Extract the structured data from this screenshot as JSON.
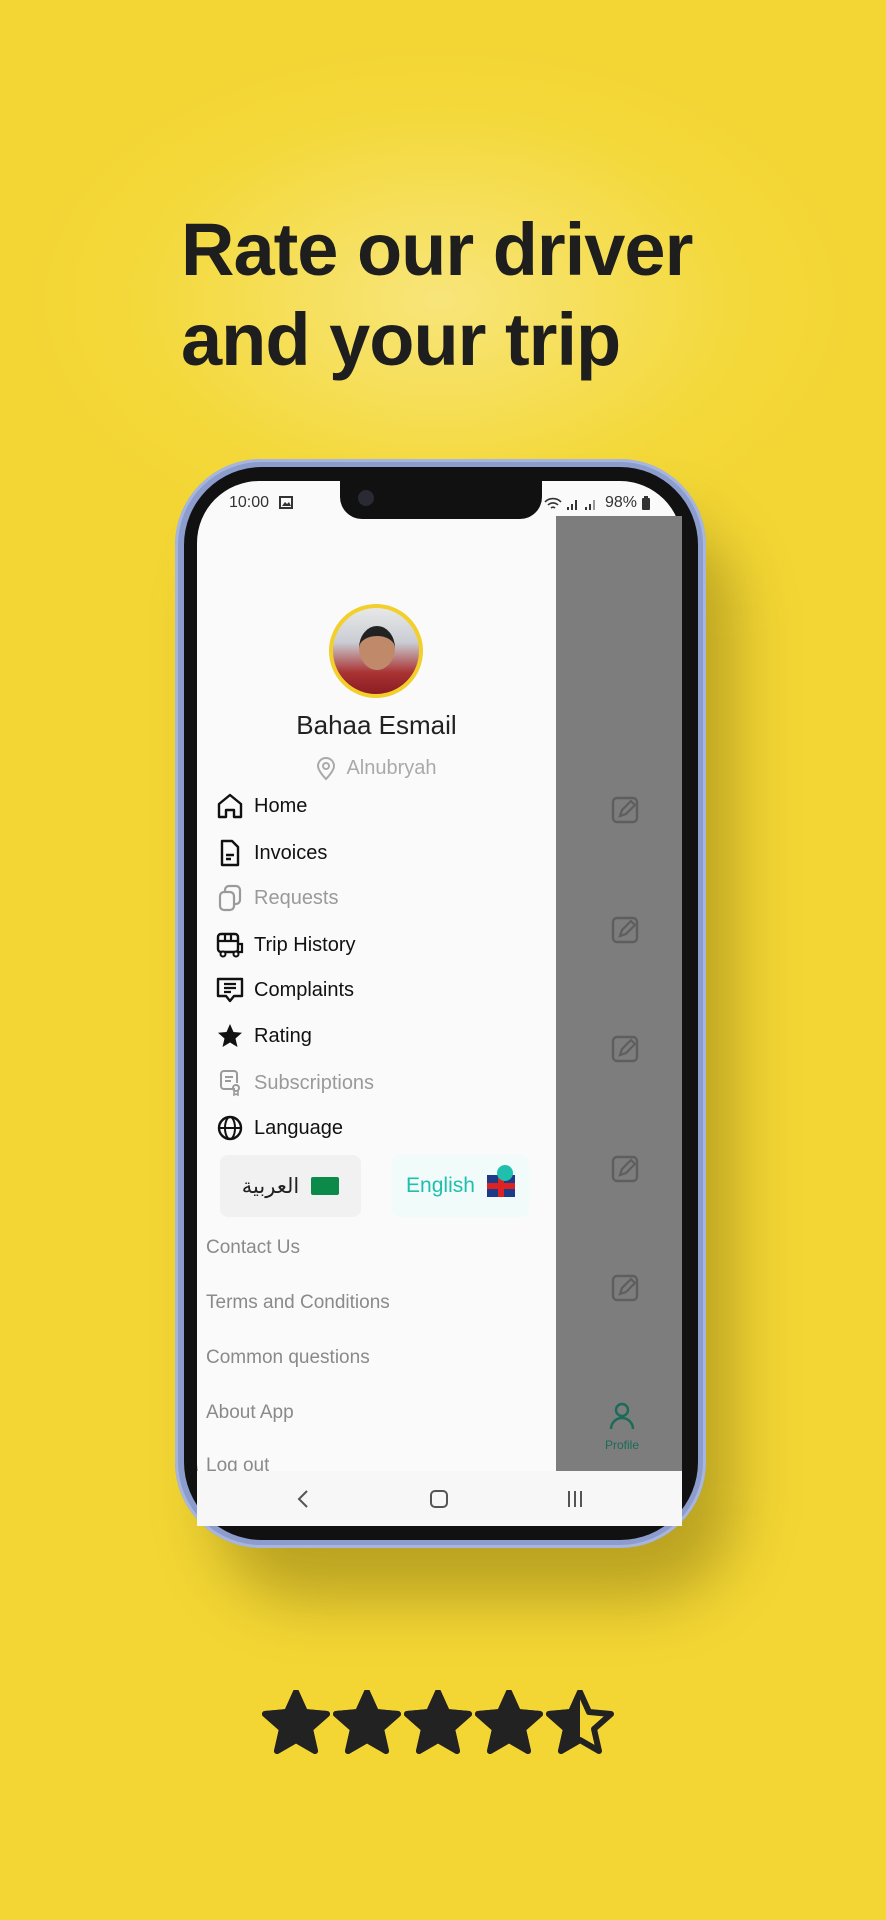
{
  "headline": {
    "line1": "Rate our driver",
    "line2": "and your trip"
  },
  "status_bar": {
    "time": "10:00",
    "battery": "98%",
    "icons": [
      "gallery-icon",
      "wifi-icon",
      "signal-icon",
      "signal-icon",
      "battery-icon"
    ]
  },
  "profile": {
    "name": "Bahaa Esmail",
    "location": "Alnubryah"
  },
  "menu": [
    {
      "label": "Home",
      "icon": "home-icon",
      "enabled": true
    },
    {
      "label": "Invoices",
      "icon": "document-icon",
      "enabled": true
    },
    {
      "label": "Requests",
      "icon": "copy-icon",
      "enabled": false
    },
    {
      "label": "Trip History",
      "icon": "bus-icon",
      "enabled": true
    },
    {
      "label": "Complaints",
      "icon": "message-icon",
      "enabled": true
    },
    {
      "label": "Rating",
      "icon": "star-icon",
      "enabled": true
    },
    {
      "label": "Subscriptions",
      "icon": "certificate-icon",
      "enabled": false
    },
    {
      "label": "Language",
      "icon": "globe-icon",
      "enabled": true
    }
  ],
  "language": {
    "arabic": "العربية",
    "english": "English",
    "selected": "English"
  },
  "links": [
    "Contact Us",
    "Terms and Conditions",
    "Common questions",
    "About App",
    "Log out"
  ],
  "bottom_tab": {
    "label": "Profile"
  },
  "rating": {
    "value": 4.5,
    "max": 5
  },
  "colors": {
    "background": "#f3d634",
    "accent": "#1fbfae",
    "profile_tab": "#1a6b57",
    "avatar_ring": "#f2cf2a"
  }
}
